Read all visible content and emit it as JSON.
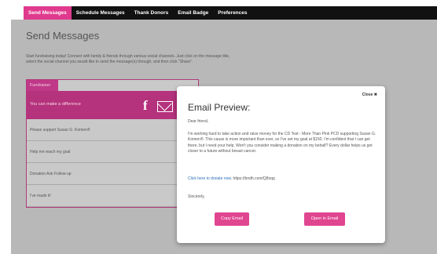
{
  "nav": {
    "items": [
      {
        "label": "Send Messages",
        "active": true
      },
      {
        "label": "Schedule Messages",
        "active": false
      },
      {
        "label": "Thank Donors",
        "active": false
      },
      {
        "label": "Email Badge",
        "active": false
      },
      {
        "label": "Preferences",
        "active": false
      }
    ]
  },
  "page": {
    "title": "Send Messages",
    "description": "Start fundraising today! Connect with family & friends through various social channels. Just click on the message title, select the social channel you would like to send the message(s) through, and then click \"Share\"."
  },
  "fundraiser": {
    "tab_label": "Fundraiser",
    "header_text": "You can make a difference",
    "fb_glyph": "f",
    "messages": [
      "Please support Susan G. Komen®",
      "Help me reach my goal",
      "Donation Ask Follow-up",
      "I've made it!"
    ]
  },
  "modal": {
    "close_label": "Close",
    "close_glyph": "✖",
    "title": "Email Preview:",
    "greeting": "Dear friend,",
    "body": "I'm working hard to take action and raise money for the CD Test - More Than Pink PCD supporting Susan G. Komen®. This cause is more important than ever, so I've set my goal at $150. I'm confident that I can get there, but I need your help. Won't you consider making a donation on my behalf? Every dollar helps us get closer to a future without breast cancer.",
    "link_label": "Click here to donate now.",
    "link_url": "https://bndh.com/Q8sqq",
    "signoff": "Sincerely,",
    "copy_button": "Copy Email",
    "open_button": "Open in Email"
  },
  "colors": {
    "accent": "#e03a8e",
    "panel_header": "#b5327c",
    "link": "#2a6fb8"
  }
}
